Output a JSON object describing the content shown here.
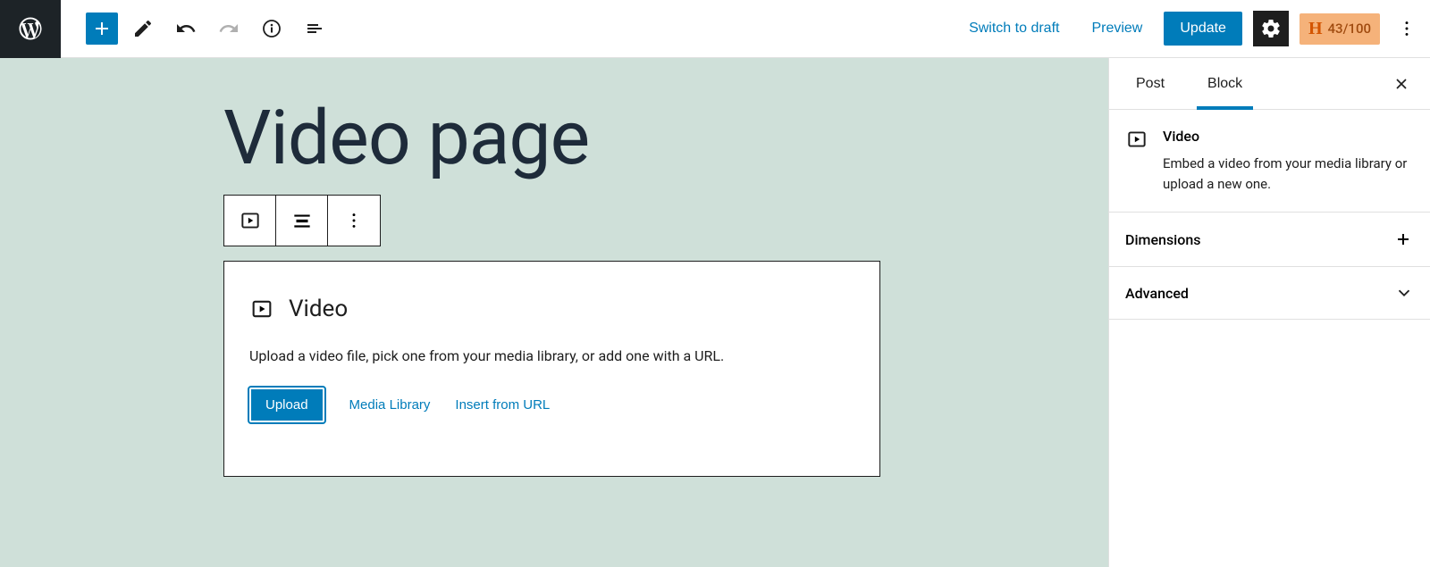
{
  "toolbar": {
    "switch_to_draft": "Switch to draft",
    "preview": "Preview",
    "update": "Update",
    "score": "43/100"
  },
  "page": {
    "title": "Video page"
  },
  "block": {
    "name": "Video",
    "instructions": "Upload a video file, pick one from your media library, or add one with a URL.",
    "actions": {
      "upload": "Upload",
      "media_library": "Media Library",
      "insert_url": "Insert from URL"
    }
  },
  "sidebar": {
    "tabs": {
      "post": "Post",
      "block": "Block"
    },
    "block_info": {
      "name": "Video",
      "description": "Embed a video from your media library or upload a new one."
    },
    "panels": {
      "dimensions": "Dimensions",
      "advanced": "Advanced"
    }
  }
}
